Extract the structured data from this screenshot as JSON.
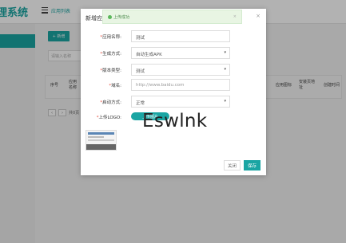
{
  "page": {
    "brand_title": "理系统",
    "breadcrumb": "应用列表",
    "add_button": "+ 新增",
    "search_placeholder": "请输入名称",
    "table_headers": [
      "序号",
      "应用名称",
      "应用图标",
      "安装页地址",
      "创建时间"
    ],
    "pager": {
      "prev": "‹",
      "next": "›",
      "text": "共0页"
    }
  },
  "modal": {
    "title": "新增应用",
    "close": "×",
    "toast": {
      "text": "上传成功",
      "close": "×"
    },
    "fields": {
      "app_name": {
        "label": "应用名称:",
        "value": "测试"
      },
      "gen_method": {
        "label": "生成方式:",
        "value": "自动生成APK"
      },
      "version_type": {
        "label": "版本类型:",
        "value": "测试"
      },
      "domain": {
        "label": "域名:",
        "placeholder": "http://www.baidu.com"
      },
      "status": {
        "label": "启动方式:",
        "value": "正常"
      },
      "logo": {
        "label": "上传LOGO:",
        "button": "上传图片"
      }
    },
    "required_mark": "*",
    "watermark": "Eswlnk",
    "buttons": {
      "cancel": "关闭",
      "save": "保存"
    }
  },
  "colors": {
    "accent": "#1aa5a3",
    "required": "#e74c3c",
    "toast_bg": "#e8f5e3"
  }
}
